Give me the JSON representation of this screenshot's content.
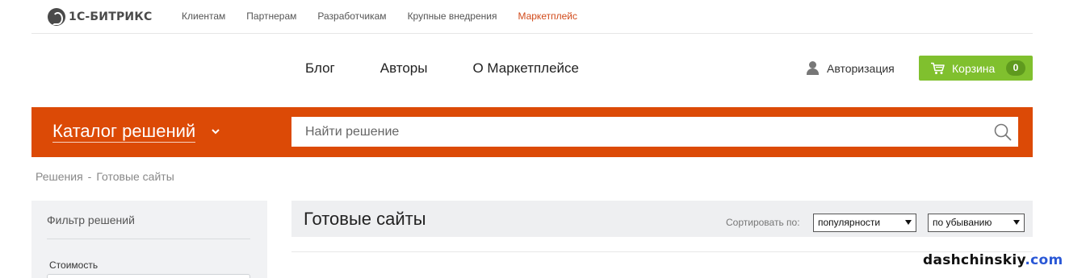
{
  "logo": {
    "text": "1С-БИТРИКС"
  },
  "top_nav": [
    {
      "label": "Клиентам"
    },
    {
      "label": "Партнерам"
    },
    {
      "label": "Разработчикам"
    },
    {
      "label": "Крупные внедрения"
    },
    {
      "label": "Маркетплейс",
      "active": true
    }
  ],
  "secondary_nav": [
    {
      "label": "Блог"
    },
    {
      "label": "Авторы"
    },
    {
      "label": "О Маркетплейсе"
    }
  ],
  "auth": {
    "label": "Авторизация",
    "icon": "user-icon"
  },
  "cart": {
    "label": "Корзина",
    "count": "0",
    "icon": "cart-icon"
  },
  "catalog": {
    "title": "Каталог решений",
    "icon": "chevron-down-icon"
  },
  "search": {
    "placeholder": "Найти решение",
    "value": "",
    "icon": "search-icon"
  },
  "breadcrumb": {
    "items": [
      "Решения",
      "Готовые сайты"
    ],
    "separator": "-"
  },
  "sidebar": {
    "filter_title": "Фильтр решений",
    "price_label": "Стоимость"
  },
  "content": {
    "title": "Готовые сайты",
    "sort_label": "Сортировать по:",
    "sort_field": {
      "selected": "популярности"
    },
    "sort_order": {
      "selected": "по убыванию"
    }
  },
  "watermark": {
    "name": "dashchinskiy",
    "domain": ".com"
  },
  "colors": {
    "accent_orange": "#dc4a06",
    "cart_green": "#80c02e",
    "active_link": "#d14a1a",
    "panel_gray": "#eeeff1"
  }
}
